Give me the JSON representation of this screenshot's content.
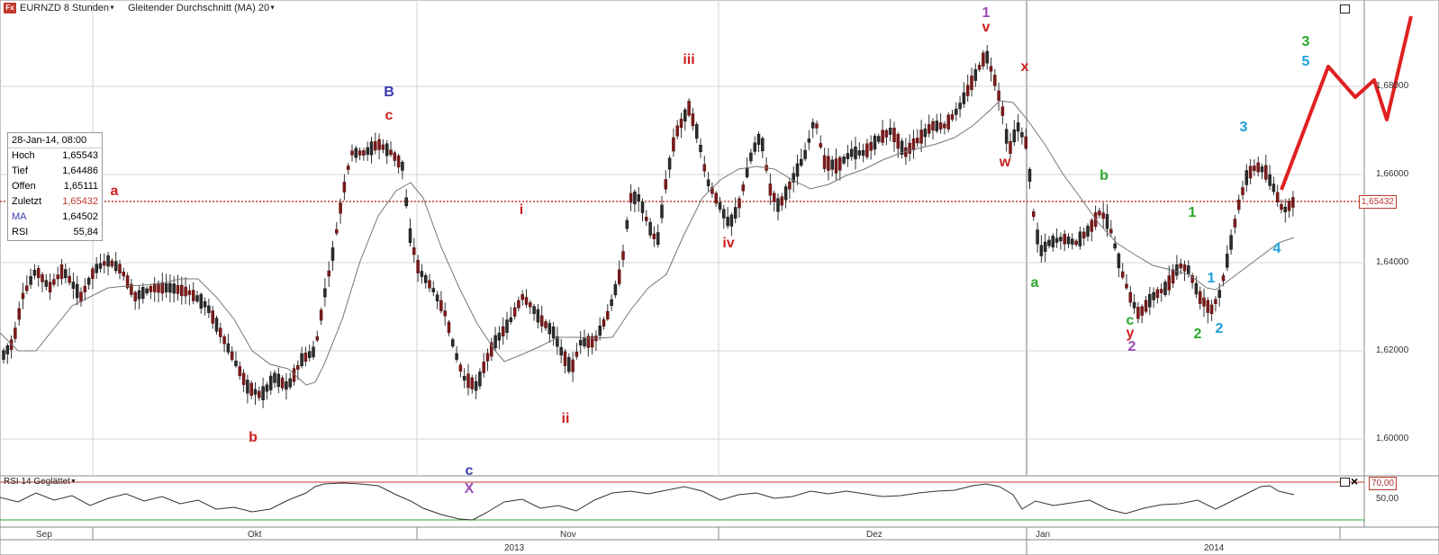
{
  "header": {
    "app_icon": "Fx",
    "instrument": "EURNZD 8 Stunden",
    "indicator": "Gleitender Durchschnitt (MA) 20"
  },
  "info_box": {
    "timestamp": "28-Jan-14, 08:00",
    "rows": [
      {
        "label": "Hoch",
        "value": "1,65543"
      },
      {
        "label": "Tief",
        "value": "1,64486"
      },
      {
        "label": "Offen",
        "value": "1,65111"
      },
      {
        "label": "Zuletzt",
        "value": "1,65432"
      },
      {
        "label": "MA",
        "value": "1,64502"
      },
      {
        "label": "RSI",
        "value": "55,84"
      }
    ]
  },
  "price_axis": [
    "1,68000",
    "1,66000",
    "1,64000",
    "1,62000",
    "1,60000"
  ],
  "last_price": "1,65432",
  "rsi_panel": {
    "title": "RSI 14 Geglättet",
    "levels": [
      "70,00",
      "50,00"
    ]
  },
  "time_axis": {
    "months": [
      "Sep",
      "Okt",
      "Nov",
      "Dez",
      "Jan"
    ],
    "years": [
      "2013",
      "2014"
    ]
  },
  "colors": {
    "bull": "#2d2d2d",
    "bear": "#7b1a1a",
    "ma": "#777777",
    "red_label": "#cc1f1f",
    "blue_label": "#3a3ab0",
    "green_label": "#2aa82a",
    "cyan_label": "#1ea0dc",
    "purple_label": "#9b4bb5",
    "projection": "#e02020"
  },
  "wave_labels": [
    {
      "text": "a",
      "color": "red_label"
    },
    {
      "text": "b",
      "color": "red_label"
    },
    {
      "text": "B",
      "color": "blue_label"
    },
    {
      "text": "c",
      "color": "red_label"
    },
    {
      "text": "c",
      "color": "blue_label"
    },
    {
      "text": "X",
      "color": "purple_label"
    },
    {
      "text": "i",
      "color": "red_label"
    },
    {
      "text": "ii",
      "color": "red_label"
    },
    {
      "text": "iii",
      "color": "red_label"
    },
    {
      "text": "iv",
      "color": "red_label"
    },
    {
      "text": "1",
      "color": "purple_label"
    },
    {
      "text": "v",
      "color": "red_label"
    },
    {
      "text": "x",
      "color": "red_label"
    },
    {
      "text": "w",
      "color": "red_label"
    },
    {
      "text": "a",
      "color": "green_label"
    },
    {
      "text": "b",
      "color": "green_label"
    },
    {
      "text": "c",
      "color": "green_label"
    },
    {
      "text": "y",
      "color": "red_label"
    },
    {
      "text": "2",
      "color": "purple_label"
    },
    {
      "text": "1",
      "color": "green_label"
    },
    {
      "text": "2",
      "color": "green_label"
    },
    {
      "text": "1",
      "color": "cyan_label"
    },
    {
      "text": "2",
      "color": "cyan_label"
    },
    {
      "text": "3",
      "color": "cyan_label"
    },
    {
      "text": "4",
      "color": "cyan_label"
    },
    {
      "text": "3",
      "color": "green_label"
    },
    {
      "text": "5",
      "color": "cyan_label"
    }
  ]
}
